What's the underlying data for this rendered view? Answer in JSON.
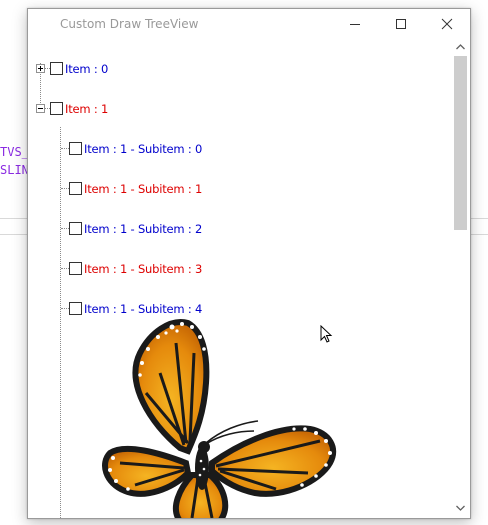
{
  "background": {
    "code_lines": [
      "TVS_",
      "SLIN"
    ]
  },
  "window": {
    "title": "Custom Draw TreeView",
    "minimize_glyph": "",
    "maximize_glyph": "",
    "close_glyph": ""
  },
  "tree": {
    "items": [
      {
        "label": "Item : 0",
        "color": "#0000cc",
        "expanded": false
      },
      {
        "label": "Item : 1",
        "color": "#dd0000",
        "expanded": true,
        "children": [
          {
            "label": "Item : 1 - Subitem : 0",
            "color": "#0000cc"
          },
          {
            "label": "Item : 1 - Subitem : 1",
            "color": "#dd0000"
          },
          {
            "label": "Item : 1 - Subitem : 2",
            "color": "#0000cc"
          },
          {
            "label": "Item : 1 - Subitem : 3",
            "color": "#dd0000"
          },
          {
            "label": "Item : 1 - Subitem : 4",
            "color": "#0000cc"
          }
        ]
      }
    ],
    "background_image": "butterfly"
  },
  "scrollbar": {
    "up_icon": "chevron-up-icon",
    "down_icon": "chevron-down-icon"
  }
}
